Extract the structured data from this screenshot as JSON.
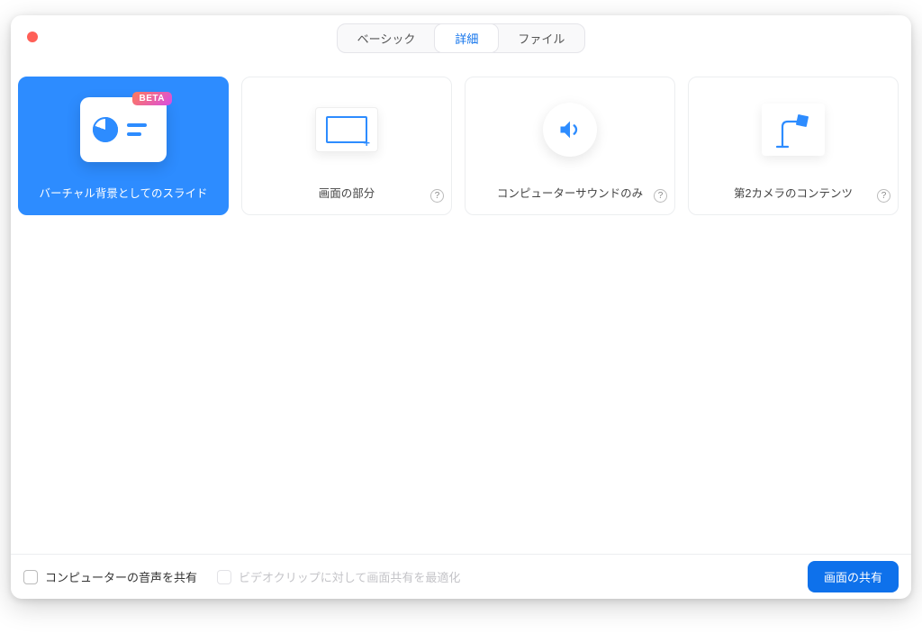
{
  "tabs": {
    "basic": "ベーシック",
    "advanced": "詳細",
    "file": "ファイル"
  },
  "cards": {
    "slides": {
      "label": "バーチャル背景としてのスライド",
      "badge": "BETA"
    },
    "portion": {
      "label": "画面の部分"
    },
    "sound": {
      "label": "コンピューターサウンドのみ"
    },
    "camera2": {
      "label": "第2カメラのコンテンツ"
    }
  },
  "footer": {
    "share_audio": "コンピューターの音声を共有",
    "optimize_video": "ビデオクリップに対して画面共有を最適化",
    "share_button": "画面の共有"
  }
}
